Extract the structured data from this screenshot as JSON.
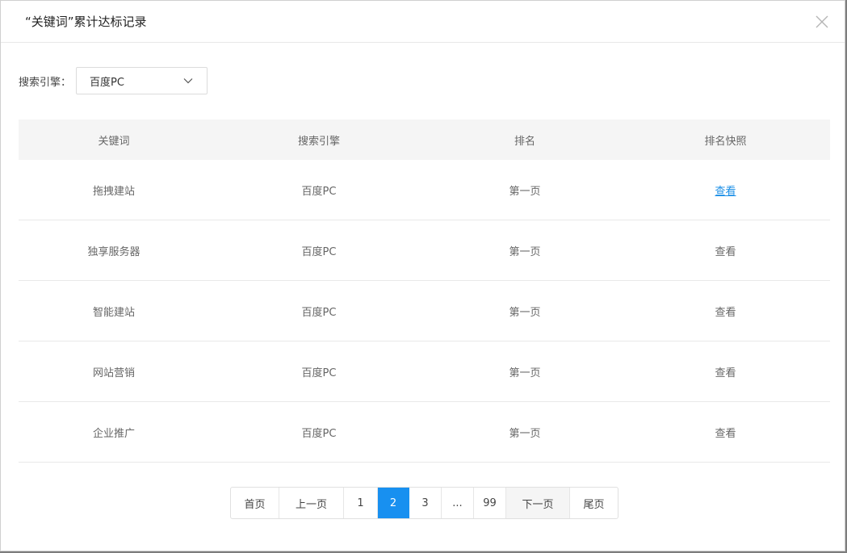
{
  "modal": {
    "title": "“关键词”累计达标记录",
    "close_icon": "close-icon"
  },
  "filter": {
    "label": "搜索引擎：",
    "selected": "百度PC",
    "chevron_icon": "chevron-down-icon"
  },
  "table": {
    "columns": [
      "关键词",
      "搜索引擎",
      "排名",
      "排名快照"
    ],
    "rows": [
      {
        "keyword": "拖拽建站",
        "engine": "百度PC",
        "rank": "第一页",
        "snapshot": "查看"
      },
      {
        "keyword": "独享服务器",
        "engine": "百度PC",
        "rank": "第一页",
        "snapshot": "查看"
      },
      {
        "keyword": "智能建站",
        "engine": "百度PC",
        "rank": "第一页",
        "snapshot": "查看"
      },
      {
        "keyword": "网站营销",
        "engine": "百度PC",
        "rank": "第一页",
        "snapshot": "查看"
      },
      {
        "keyword": "企业推广",
        "engine": "百度PC",
        "rank": "第一页",
        "snapshot": "查看"
      }
    ]
  },
  "pagination": {
    "first": "首页",
    "prev": "上一页",
    "pages": [
      "1",
      "2",
      "3"
    ],
    "current": "2",
    "ellipsis": "...",
    "last_page": "99",
    "next": "下一页",
    "last": "尾页"
  },
  "colors": {
    "accent": "#1890f0",
    "link_active": "#1a8ee6"
  }
}
